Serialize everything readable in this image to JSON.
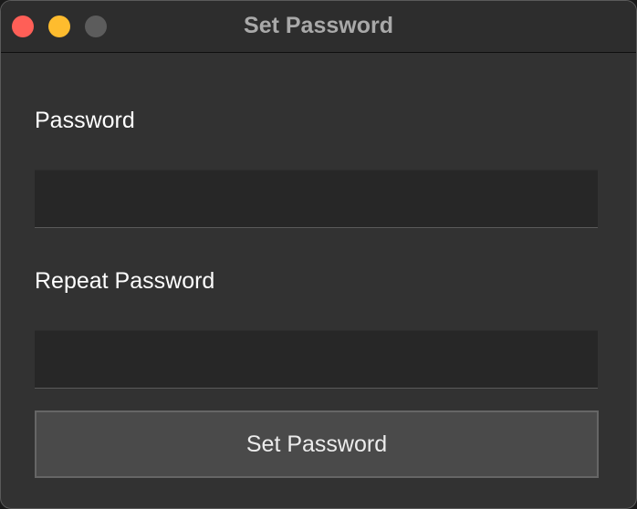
{
  "window": {
    "title": "Set Password",
    "controls": {
      "close": {
        "icon": "close-dot-icon",
        "color": "#ff5f57"
      },
      "minimize": {
        "icon": "minimize-dot-icon",
        "color": "#febc2e"
      },
      "zoom": {
        "icon": "zoom-dot-icon",
        "color": "#5c5c5c"
      }
    }
  },
  "form": {
    "password_label": "Password",
    "password_value": "",
    "repeat_label": "Repeat Password",
    "repeat_value": "",
    "submit_label": "Set Password"
  },
  "colors": {
    "window_bg": "#323232",
    "input_bg": "#272727",
    "button_bg": "#4a4a4a"
  }
}
